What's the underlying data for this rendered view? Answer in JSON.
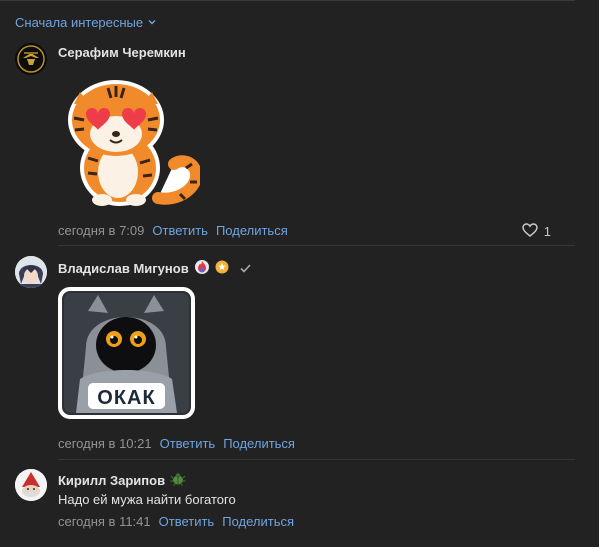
{
  "sort": {
    "label": "Сначала интересные",
    "icon": "chevron-down-icon",
    "color": "#6fa5e0"
  },
  "comments": [
    {
      "author": "Серафим Черемкин",
      "avatar": "emblem-avatar",
      "sticker": "tiger-heart-eyes-sticker",
      "time": "сегодня в 7:09",
      "reply_label": "Ответить",
      "share_label": "Поделиться",
      "likes": "1"
    },
    {
      "author": "Владислав Мигунов",
      "avatar": "anime-avatar",
      "badges": [
        "fire-badge-icon",
        "star-badge-icon",
        "check-icon"
      ],
      "sticker": "okak-cat-sticker",
      "sticker_text": "ОКАК",
      "time": "сегодня в 10:21",
      "reply_label": "Ответить",
      "share_label": "Поделиться"
    },
    {
      "author": "Кирилл Зарипов",
      "avatar": "gnome-avatar",
      "badges": [
        "bug-badge-icon"
      ],
      "text": "Надо ей мужа найти богатого",
      "time": "сегодня в 11:41",
      "reply_label": "Ответить",
      "share_label": "Поделиться"
    }
  ],
  "colors": {
    "background": "#222222",
    "link": "#6fa5e0",
    "muted": "#939393",
    "text": "#e1e3e6"
  }
}
